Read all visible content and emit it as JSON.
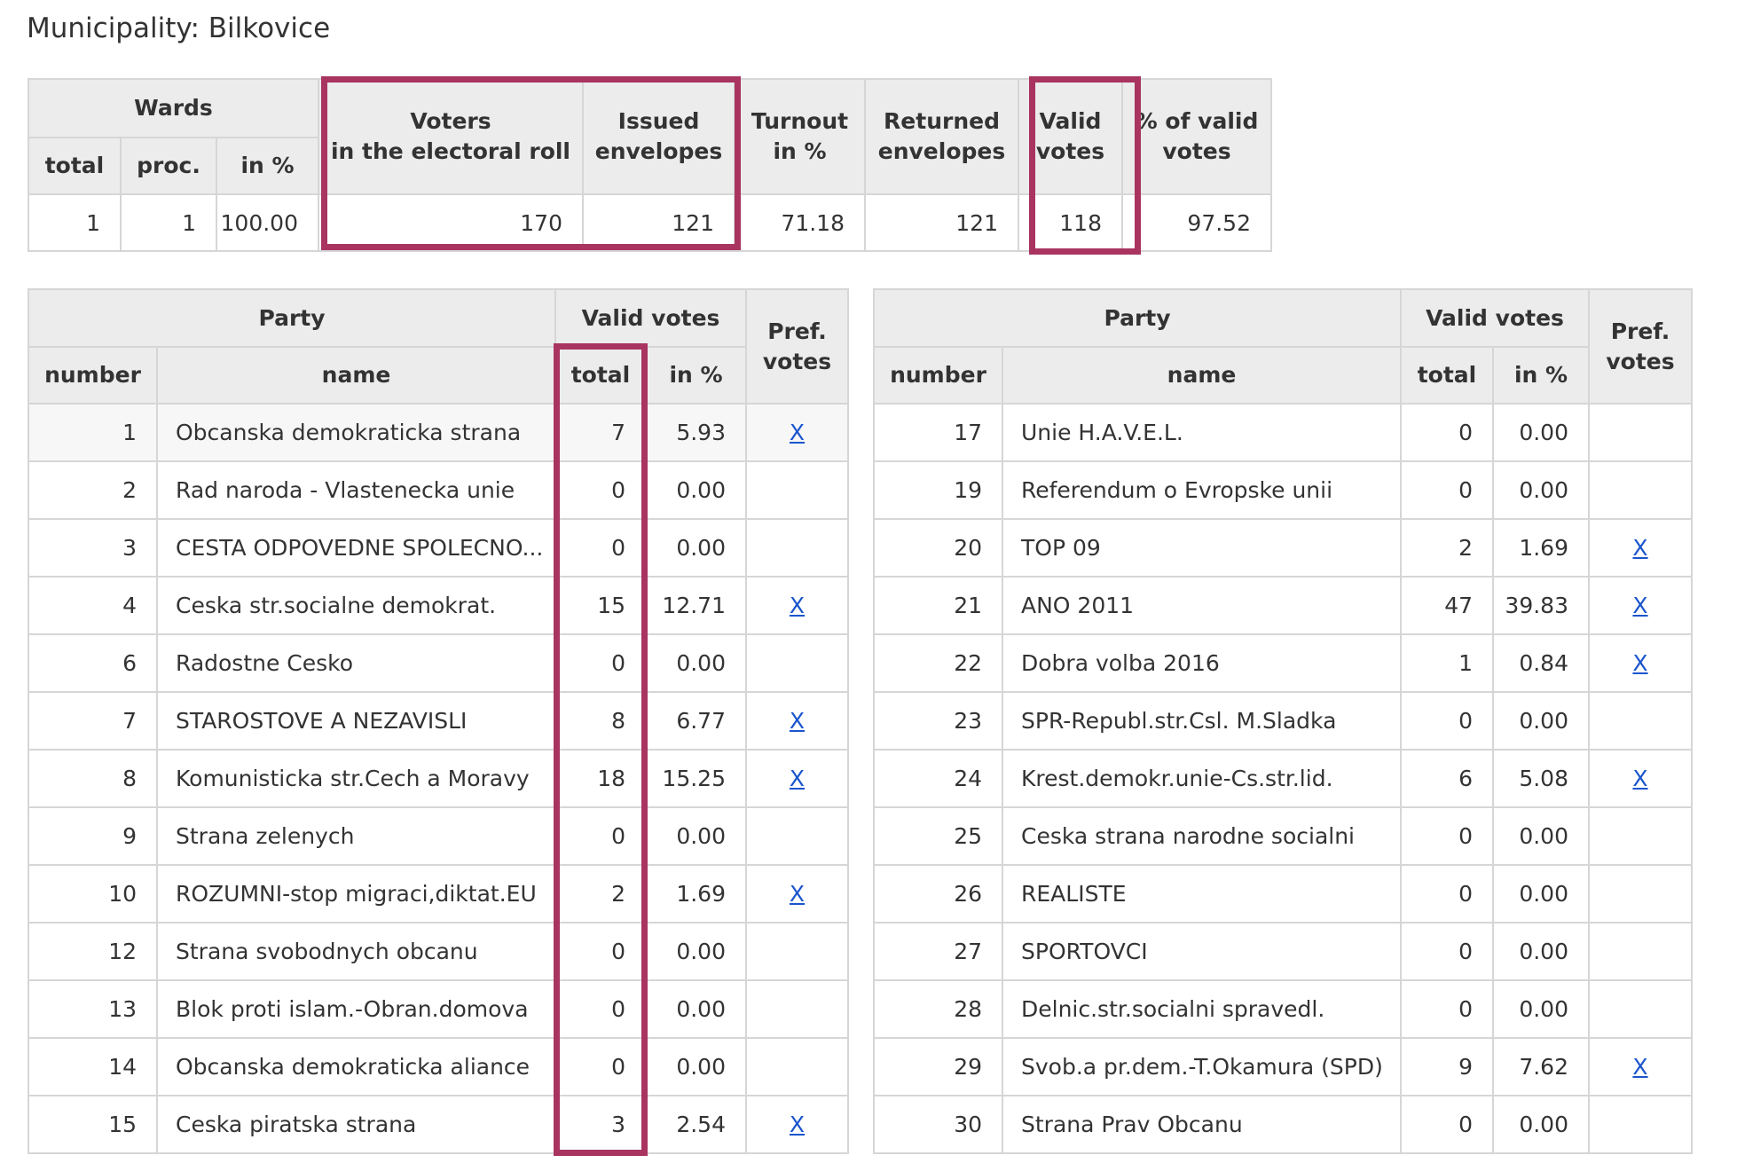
{
  "municipality_title": "Municipality: Bilkovice",
  "summary": {
    "headers": {
      "wards": "Wards",
      "total": "total",
      "proc": "proc.",
      "in_pct": "in %",
      "voters_line1": "Voters",
      "voters_line2": "in the electoral roll",
      "issued_line1": "Issued",
      "issued_line2": "envelopes",
      "turnout_line1": "Turnout",
      "turnout_line2": "in %",
      "returned_line1": "Returned",
      "returned_line2": "envelopes",
      "valid_line1": "Valid",
      "valid_line2": "votes",
      "pct_valid_line1": "% of valid",
      "pct_valid_line2": "votes"
    },
    "row": {
      "wards_total": "1",
      "wards_proc": "1",
      "wards_pct": "100.00",
      "voters": "170",
      "issued": "121",
      "turnout": "71.18",
      "returned": "121",
      "valid": "118",
      "pct_valid": "97.52"
    }
  },
  "party_headers": {
    "party": "Party",
    "valid_votes": "Valid votes",
    "pref_line1": "Pref.",
    "pref_line2": "votes",
    "number": "number",
    "name": "name",
    "total": "total",
    "in_pct": "in %"
  },
  "pref_link_label": "X",
  "parties_left": [
    {
      "number": "1",
      "name": "Obcanska demokraticka strana",
      "total": "7",
      "pct": "5.93",
      "pref": true
    },
    {
      "number": "2",
      "name": "Rad naroda - Vlastenecka unie",
      "total": "0",
      "pct": "0.00",
      "pref": false
    },
    {
      "number": "3",
      "name": "CESTA ODPOVEDNE SPOLECNO...",
      "total": "0",
      "pct": "0.00",
      "pref": false
    },
    {
      "number": "4",
      "name": "Ceska str.socialne demokrat.",
      "total": "15",
      "pct": "12.71",
      "pref": true
    },
    {
      "number": "6",
      "name": "Radostne Cesko",
      "total": "0",
      "pct": "0.00",
      "pref": false
    },
    {
      "number": "7",
      "name": "STAROSTOVE A NEZAVISLI",
      "total": "8",
      "pct": "6.77",
      "pref": true
    },
    {
      "number": "8",
      "name": "Komunisticka str.Cech a Moravy",
      "total": "18",
      "pct": "15.25",
      "pref": true
    },
    {
      "number": "9",
      "name": "Strana zelenych",
      "total": "0",
      "pct": "0.00",
      "pref": false
    },
    {
      "number": "10",
      "name": "ROZUMNI-stop migraci,diktat.EU",
      "total": "2",
      "pct": "1.69",
      "pref": true
    },
    {
      "number": "12",
      "name": "Strana svobodnych obcanu",
      "total": "0",
      "pct": "0.00",
      "pref": false
    },
    {
      "number": "13",
      "name": "Blok proti islam.-Obran.domova",
      "total": "0",
      "pct": "0.00",
      "pref": false
    },
    {
      "number": "14",
      "name": "Obcanska demokraticka aliance",
      "total": "0",
      "pct": "0.00",
      "pref": false
    },
    {
      "number": "15",
      "name": "Ceska piratska strana",
      "total": "3",
      "pct": "2.54",
      "pref": true
    }
  ],
  "parties_right": [
    {
      "number": "17",
      "name": "Unie H.A.V.E.L.",
      "total": "0",
      "pct": "0.00",
      "pref": false
    },
    {
      "number": "19",
      "name": "Referendum o Evropske unii",
      "total": "0",
      "pct": "0.00",
      "pref": false
    },
    {
      "number": "20",
      "name": "TOP 09",
      "total": "2",
      "pct": "1.69",
      "pref": true
    },
    {
      "number": "21",
      "name": "ANO 2011",
      "total": "47",
      "pct": "39.83",
      "pref": true
    },
    {
      "number": "22",
      "name": "Dobra volba 2016",
      "total": "1",
      "pct": "0.84",
      "pref": true
    },
    {
      "number": "23",
      "name": "SPR-Republ.str.Csl. M.Sladka",
      "total": "0",
      "pct": "0.00",
      "pref": false
    },
    {
      "number": "24",
      "name": "Krest.demokr.unie-Cs.str.lid.",
      "total": "6",
      "pct": "5.08",
      "pref": true
    },
    {
      "number": "25",
      "name": "Ceska strana narodne socialni",
      "total": "0",
      "pct": "0.00",
      "pref": false
    },
    {
      "number": "26",
      "name": "REALISTE",
      "total": "0",
      "pct": "0.00",
      "pref": false
    },
    {
      "number": "27",
      "name": "SPORTOVCI",
      "total": "0",
      "pct": "0.00",
      "pref": false
    },
    {
      "number": "28",
      "name": "Delnic.str.socialni spravedl.",
      "total": "0",
      "pct": "0.00",
      "pref": false
    },
    {
      "number": "29",
      "name": "Svob.a pr.dem.-T.Okamura (SPD)",
      "total": "9",
      "pct": "7.62",
      "pref": true
    },
    {
      "number": "30",
      "name": "Strana Prav Obcanu",
      "total": "0",
      "pct": "0.00",
      "pref": false
    }
  ],
  "highlight_color": "#a8345f",
  "link_color": "#1a55cc"
}
